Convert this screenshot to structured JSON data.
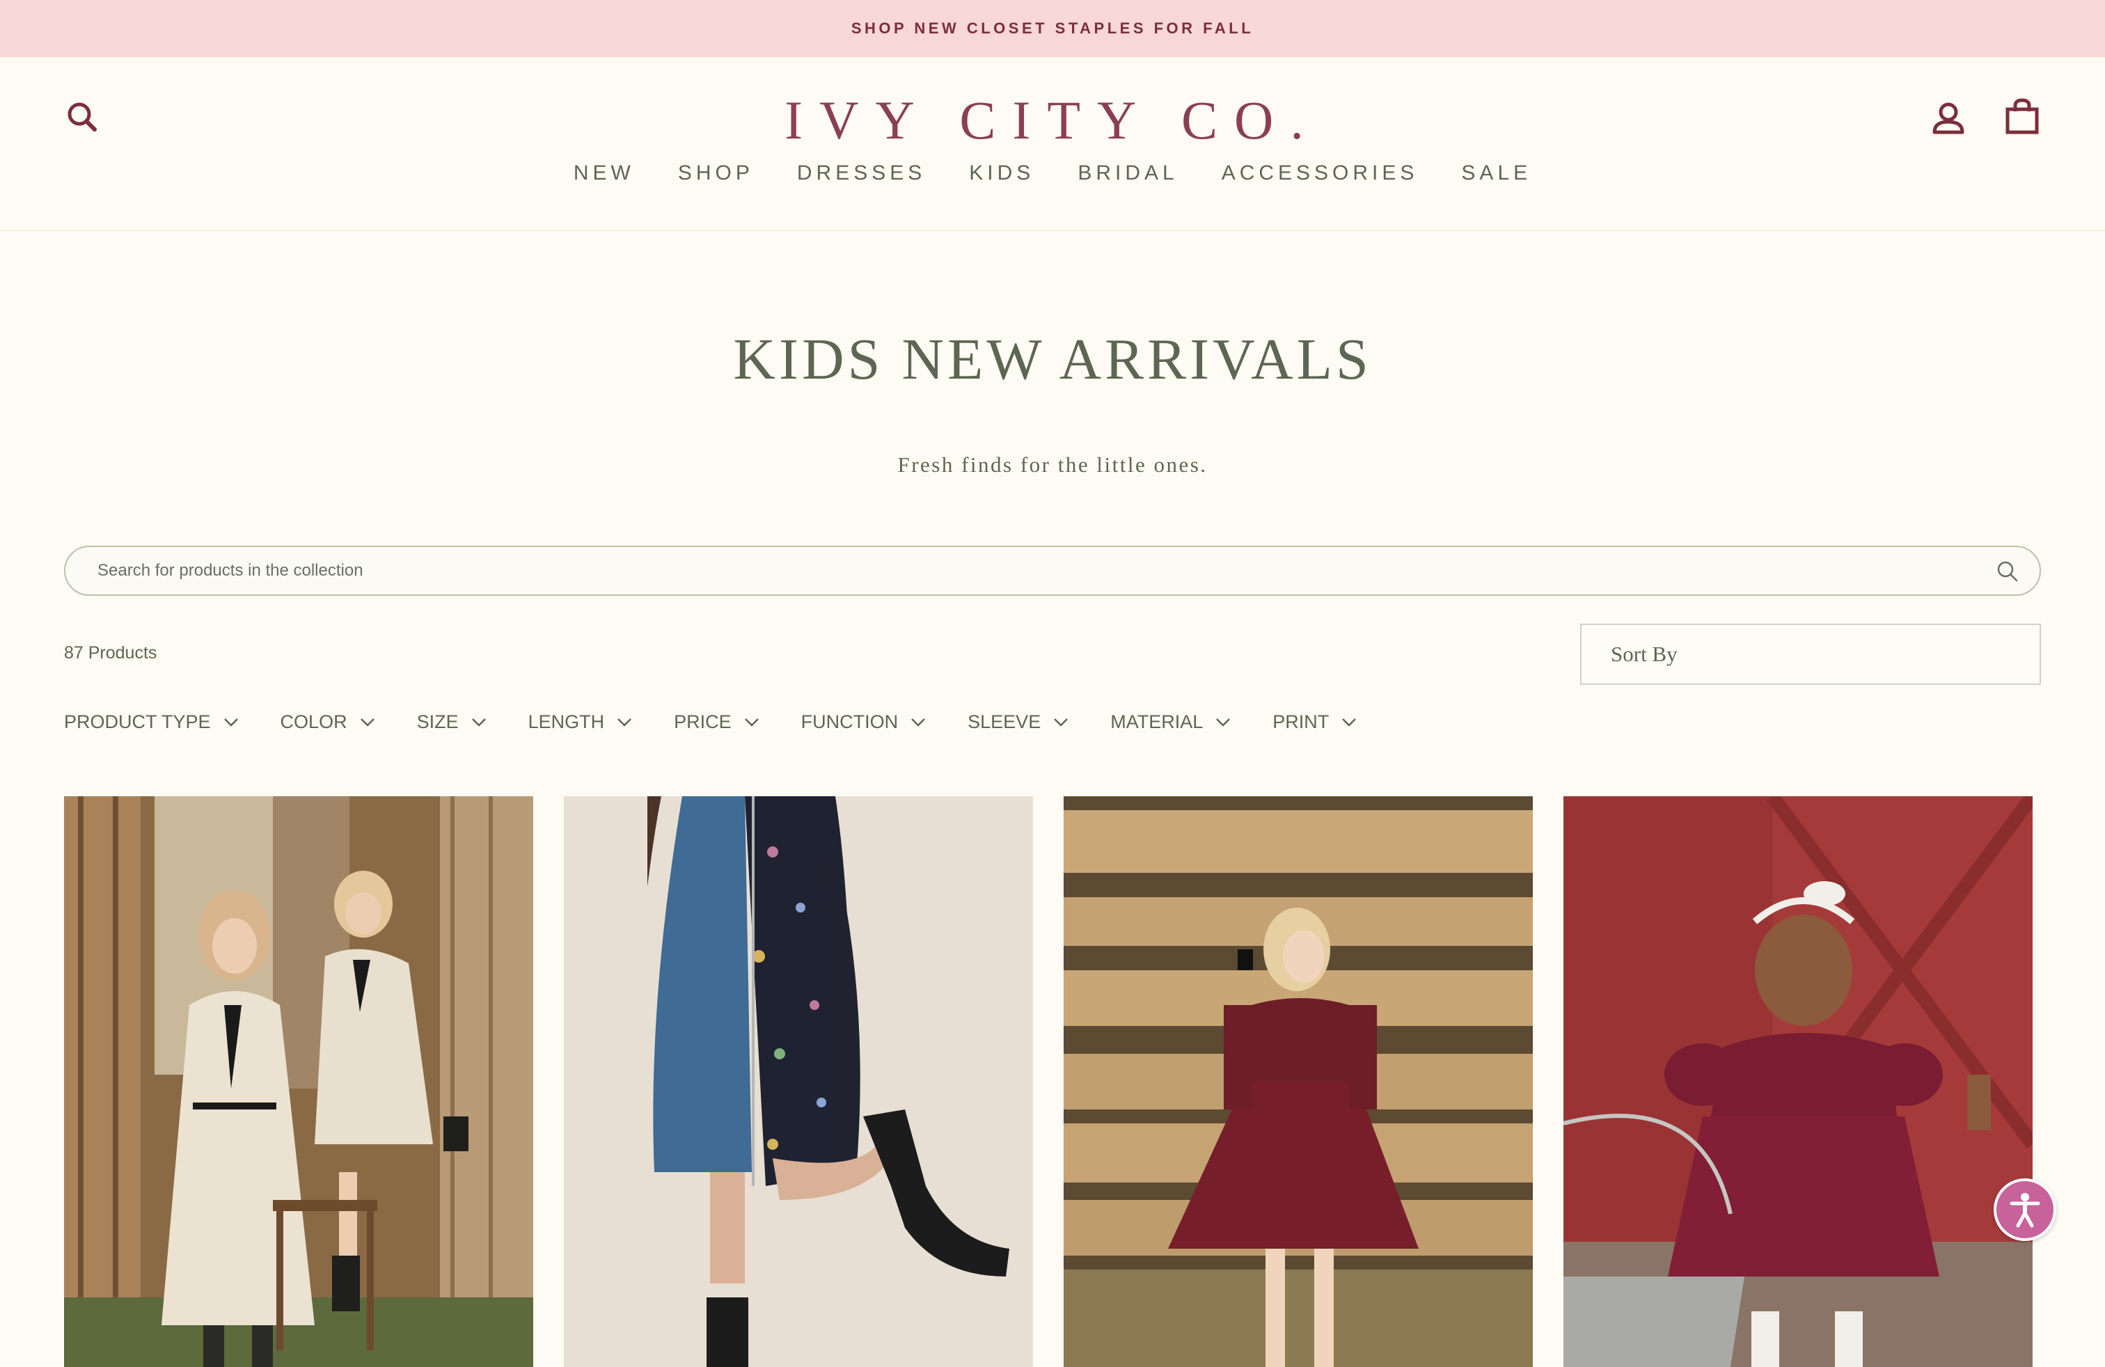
{
  "announcement": {
    "text": "SHOP NEW CLOSET STAPLES FOR FALL"
  },
  "header": {
    "logo": "IVY CITY CO.",
    "nav": [
      "NEW",
      "SHOP",
      "DRESSES",
      "KIDS",
      "BRIDAL",
      "ACCESSORIES",
      "SALE"
    ],
    "icons": {
      "search": "search-icon",
      "account": "user-icon",
      "cart": "shopping-bag-icon"
    }
  },
  "collection": {
    "title": "KIDS NEW ARRIVALS",
    "subtitle": "Fresh finds for the little ones.",
    "search_placeholder": "Search for products in the collection",
    "product_count": "87 Products",
    "sort_label": "Sort By",
    "filters": [
      "PRODUCT TYPE",
      "COLOR",
      "SIZE",
      "LENGTH",
      "PRICE",
      "FUNCTION",
      "SLEEVE",
      "MATERIAL",
      "PRINT"
    ]
  },
  "colors": {
    "announcement_bg": "#f8d7d7",
    "brand": "#8a3f55",
    "text": "#5d6653",
    "page_bg": "#fdfbf3",
    "accessibility": "#c8629b"
  }
}
